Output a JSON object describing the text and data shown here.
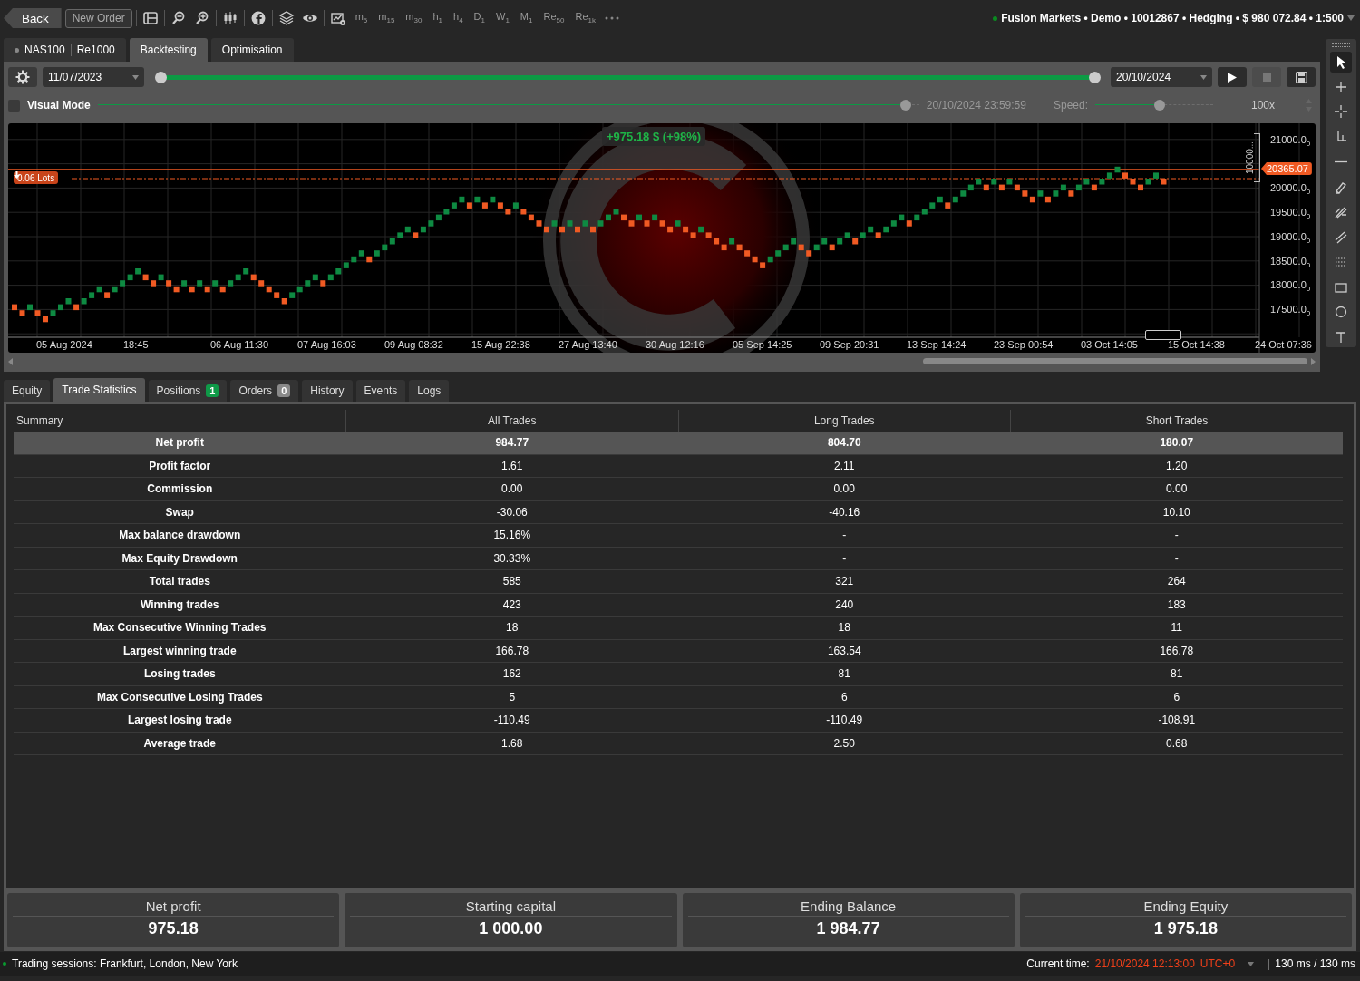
{
  "toolbar": {
    "back": "Back",
    "new_order": "New Order",
    "timeframes": [
      "m$_{5}$",
      "m$_{15}$",
      "m$_{30}$",
      "h$_{1}$",
      "h$_{4}$",
      "D$_{1}$",
      "W$_{1}$",
      "M$_{1}$",
      "Re$_{50}$",
      "Re$_{1k}$"
    ],
    "account": {
      "connected": true,
      "text": "Fusion Markets • Demo • 10012867 • Hedging • $ 980 072.84 • 1:500"
    }
  },
  "symbol_tabs": [
    {
      "kind": "symbol",
      "symbol": "NAS100",
      "timeframe": "Re1000",
      "selected": false
    },
    {
      "kind": "plain",
      "label": "Backtesting",
      "selected": true
    },
    {
      "kind": "plain",
      "label": "Optimisation",
      "selected": false
    }
  ],
  "backtest": {
    "start_date": "11/07/2023",
    "end_date": "20/10/2024",
    "range_slider": {
      "level": 1
    },
    "play_disabled": false,
    "stop_disabled": true,
    "visual_mode": {
      "label": "Visual Mode",
      "checked": false,
      "level": 0.99,
      "time": "20/10/2024 23:59:59",
      "speed_label": "Speed:",
      "speed_slider": {
        "level": 0.55
      },
      "speed": "100x"
    }
  },
  "chart": {
    "profit": "+975.18 $ (+98%)",
    "lots": "0.06 Lots",
    "price": "20365.07",
    "range_label": "10000...",
    "price_axis": [
      "21000.0$_{0}$",
      "20000.0$_{0}$",
      "19500.0$_{0}$",
      "19000.0$_{0}$",
      "18500.0$_{0}$",
      "18000.0$_{0}$",
      "17500.0$_{0}$"
    ],
    "time_axis": [
      "05 Aug 2024",
      "18:45",
      "06 Aug 11:30",
      "07 Aug 16:03",
      "09 Aug 08:32",
      "15 Aug 22:38",
      "27 Aug 13:40",
      "30 Aug 12:16",
      "05 Sep 14:25",
      "09 Sep 20:31",
      "13 Sep 14:24",
      "23 Sep 00:54",
      "03 Oct 14:05",
      "15 Oct 14:38",
      "24 Oct 07:36"
    ]
  },
  "bottom_tabs": [
    {
      "label": "Equity",
      "selected": false
    },
    {
      "label": "Trade Statistics",
      "selected": true
    },
    {
      "label": "Positions",
      "selected": false,
      "badge": {
        "text": "1",
        "color": "#0f9a48"
      }
    },
    {
      "label": "Orders",
      "selected": false,
      "badge": {
        "text": "0",
        "color": "#8a8a8a"
      }
    },
    {
      "label": "History",
      "selected": false
    },
    {
      "label": "Events",
      "selected": false
    },
    {
      "label": "Logs",
      "selected": false
    }
  ],
  "table": {
    "columns": [
      "Summary",
      "All Trades",
      "Long Trades",
      "Short Trades"
    ],
    "rows": [
      {
        "selected": true,
        "cells": [
          "Net profit",
          "984.77",
          "804.70",
          "180.07"
        ]
      },
      {
        "selected": false,
        "cells": [
          "Profit factor",
          "1.61",
          "2.11",
          "1.20"
        ]
      },
      {
        "selected": false,
        "cells": [
          "Commission",
          "0.00",
          "0.00",
          "0.00"
        ]
      },
      {
        "selected": false,
        "cells": [
          "Swap",
          "-30.06",
          "-40.16",
          "10.10"
        ]
      },
      {
        "selected": false,
        "cells": [
          "Max balance drawdown",
          "15.16%",
          "-",
          "-"
        ]
      },
      {
        "selected": false,
        "cells": [
          "Max Equity Drawdown",
          "30.33%",
          "-",
          "-"
        ]
      },
      {
        "selected": false,
        "cells": [
          "Total trades",
          "585",
          "321",
          "264"
        ]
      },
      {
        "selected": false,
        "cells": [
          "Winning trades",
          "423",
          "240",
          "183"
        ]
      },
      {
        "selected": false,
        "cells": [
          "Max Consecutive Winning Trades",
          "18",
          "18",
          "11"
        ]
      },
      {
        "selected": false,
        "cells": [
          "Largest winning trade",
          "166.78",
          "163.54",
          "166.78"
        ]
      },
      {
        "selected": false,
        "cells": [
          "Losing trades",
          "162",
          "81",
          "81"
        ]
      },
      {
        "selected": false,
        "cells": [
          "Max Consecutive Losing Trades",
          "5",
          "6",
          "6"
        ]
      },
      {
        "selected": false,
        "cells": [
          "Largest losing trade",
          "-110.49",
          "-110.49",
          "-108.91"
        ]
      },
      {
        "selected": false,
        "cells": [
          "Average trade",
          "1.68",
          "2.50",
          "0.68"
        ]
      }
    ]
  },
  "summary_cards": [
    {
      "label": "Net profit",
      "value": "975.18"
    },
    {
      "label": "Starting capital",
      "value": "1 000.00"
    },
    {
      "label": "Ending Balance",
      "value": "1 984.77"
    },
    {
      "label": "Ending Equity",
      "value": "1 975.18"
    }
  ],
  "status_bar": {
    "sessions": "Trading sessions: Frankfurt, London, New York",
    "time_label": "Current time:",
    "time": "21/10/2024 12:13:00",
    "timezone": "UTC+0",
    "separator": "|",
    "latency": "130 ms / 130 ms"
  }
}
